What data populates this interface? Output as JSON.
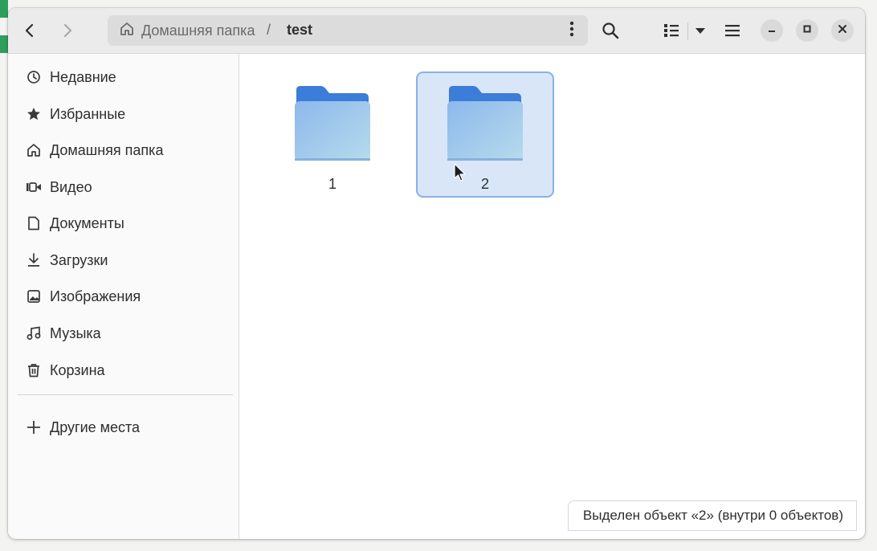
{
  "header": {
    "path_home_label": "Домашняя папка",
    "path_separator": "/",
    "path_current": "test",
    "icons": {
      "back": "chevron-left-icon",
      "forward": "chevron-right-icon",
      "search": "search-icon",
      "view": "list-view-icon",
      "view_menu": "triangle-down-icon",
      "menu": "hamburger-icon",
      "minimize": "minimize-icon",
      "maximize": "maximize-icon",
      "close": "close-icon"
    }
  },
  "sidebar": {
    "items": [
      {
        "label": "Недавние",
        "icon": "clock-icon"
      },
      {
        "label": "Избранные",
        "icon": "star-icon"
      },
      {
        "label": "Домашняя папка",
        "icon": "home-icon"
      },
      {
        "label": "Видео",
        "icon": "video-icon"
      },
      {
        "label": "Документы",
        "icon": "document-icon"
      },
      {
        "label": "Загрузки",
        "icon": "download-icon"
      },
      {
        "label": "Изображения",
        "icon": "image-icon"
      },
      {
        "label": "Музыка",
        "icon": "music-icon"
      },
      {
        "label": "Корзина",
        "icon": "trash-icon"
      }
    ],
    "other_places": {
      "label": "Другие места",
      "icon": "plus-icon"
    }
  },
  "files": [
    {
      "name": "1",
      "type": "folder",
      "selected": false
    },
    {
      "name": "2",
      "type": "folder",
      "selected": true
    }
  ],
  "status": {
    "text": "Выделен объект «2»  (внутри 0 объектов)"
  },
  "colors": {
    "accent": "#3584e4",
    "folder_top": "#3d7fd9",
    "folder_body": "#9cc3ee",
    "selection_bg": "#d9e6f8",
    "selection_border": "#88b1e6"
  }
}
